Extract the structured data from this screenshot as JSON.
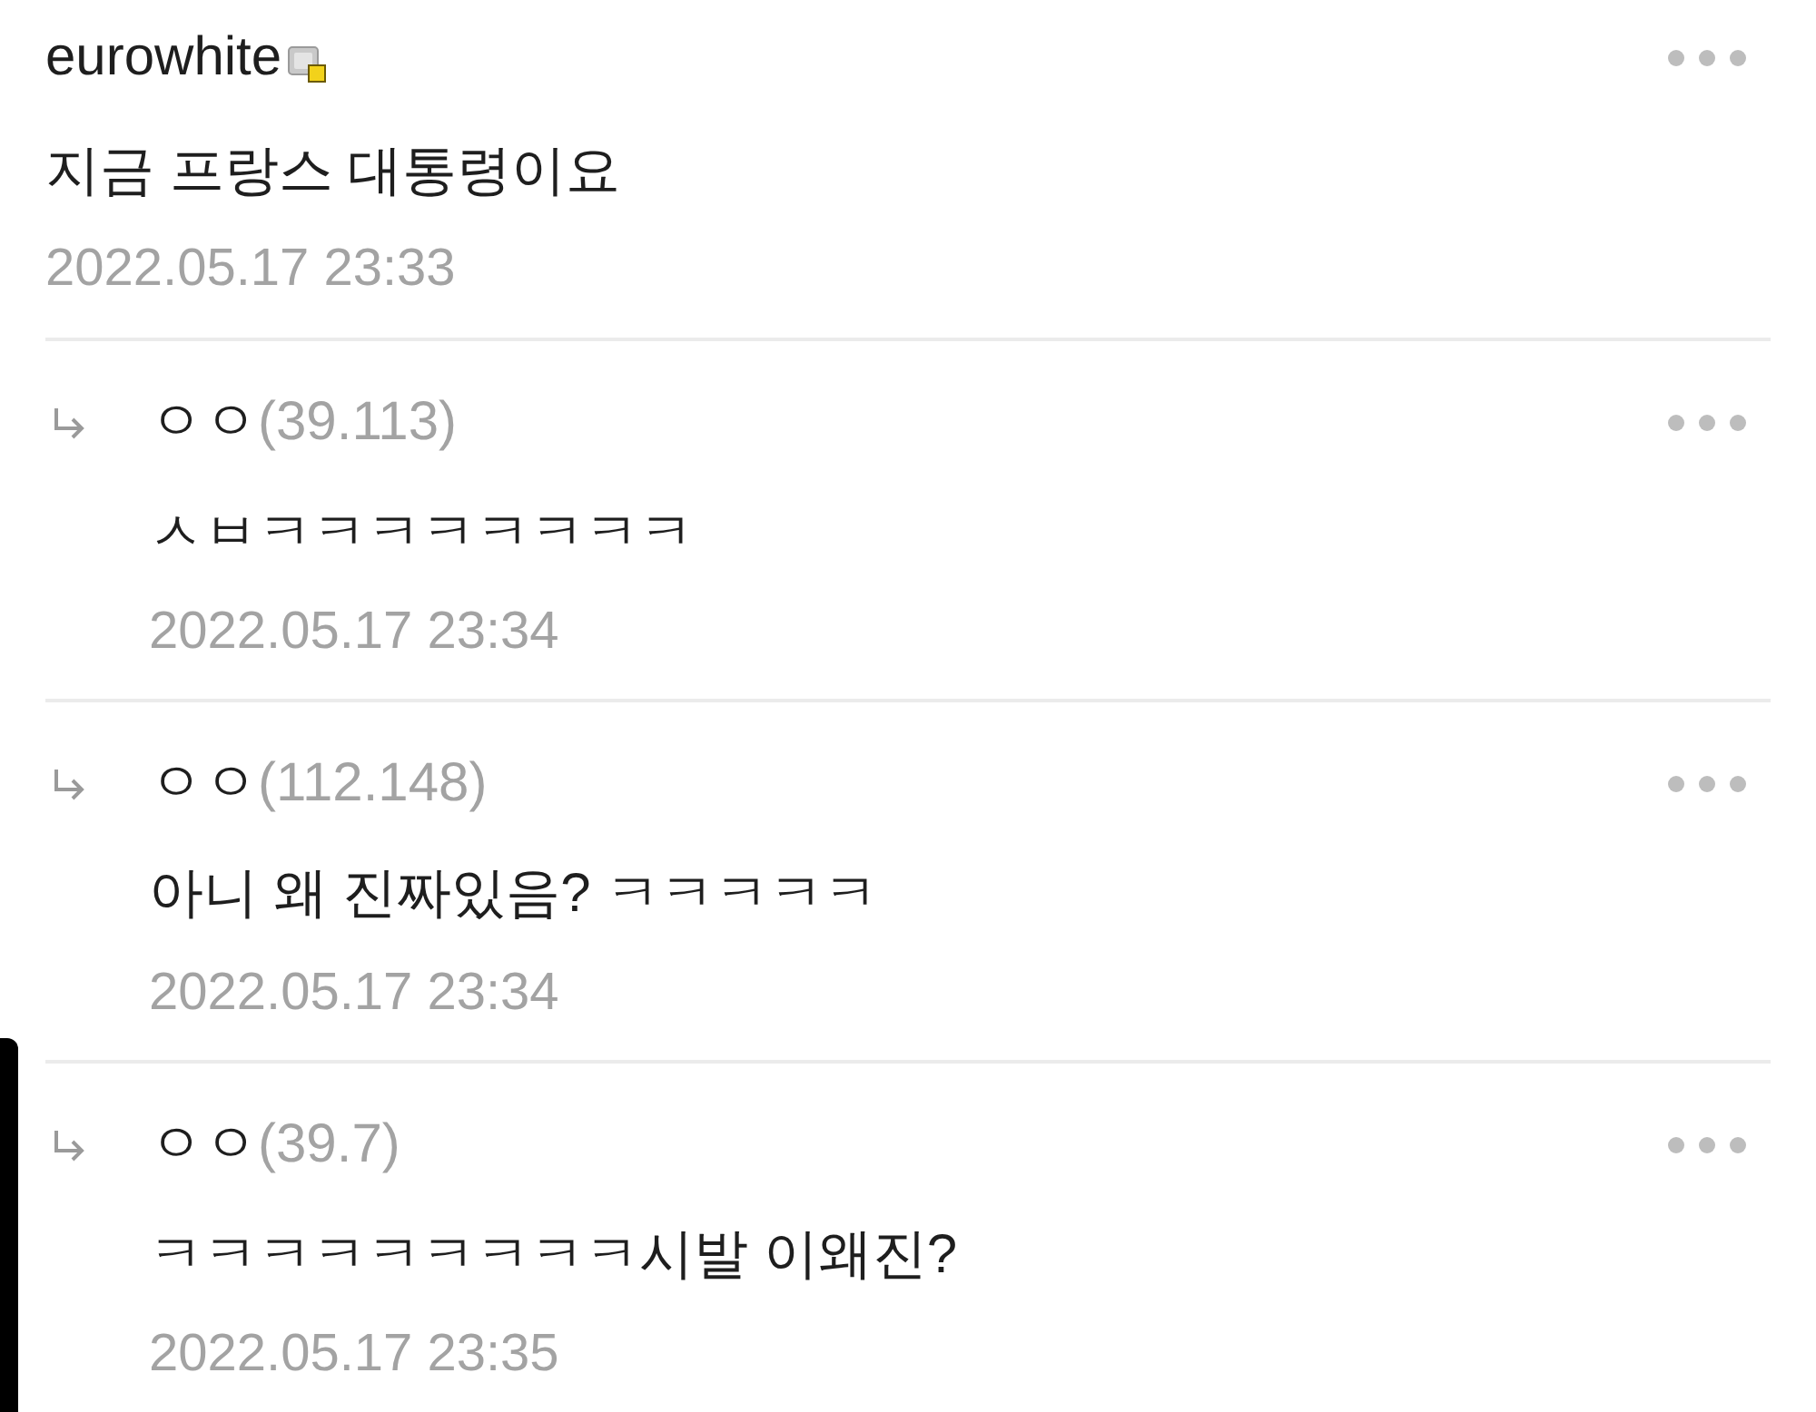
{
  "comments": [
    {
      "kind": "comment",
      "author": "eurowhite",
      "text": "지금 프랑스 대통령이요",
      "date": "2022.05.17 23:33"
    },
    {
      "kind": "reply",
      "author": "ㅇㅇ",
      "ip": "(39.113)",
      "text": "ㅅㅂㅋㅋㅋㅋㅋㅋㅋㅋ",
      "date": "2022.05.17 23:34"
    },
    {
      "kind": "reply",
      "author": "ㅇㅇ",
      "ip": "(112.148)",
      "text": "아니 왜 진짜있음? ㅋㅋㅋㅋㅋ",
      "date": "2022.05.17 23:34"
    },
    {
      "kind": "reply",
      "author": "ㅇㅇ",
      "ip": "(39.7)",
      "text": "ㅋㅋㅋㅋㅋㅋㅋㅋㅋ시발 이왜진?",
      "date": "2022.05.17 23:35"
    }
  ]
}
